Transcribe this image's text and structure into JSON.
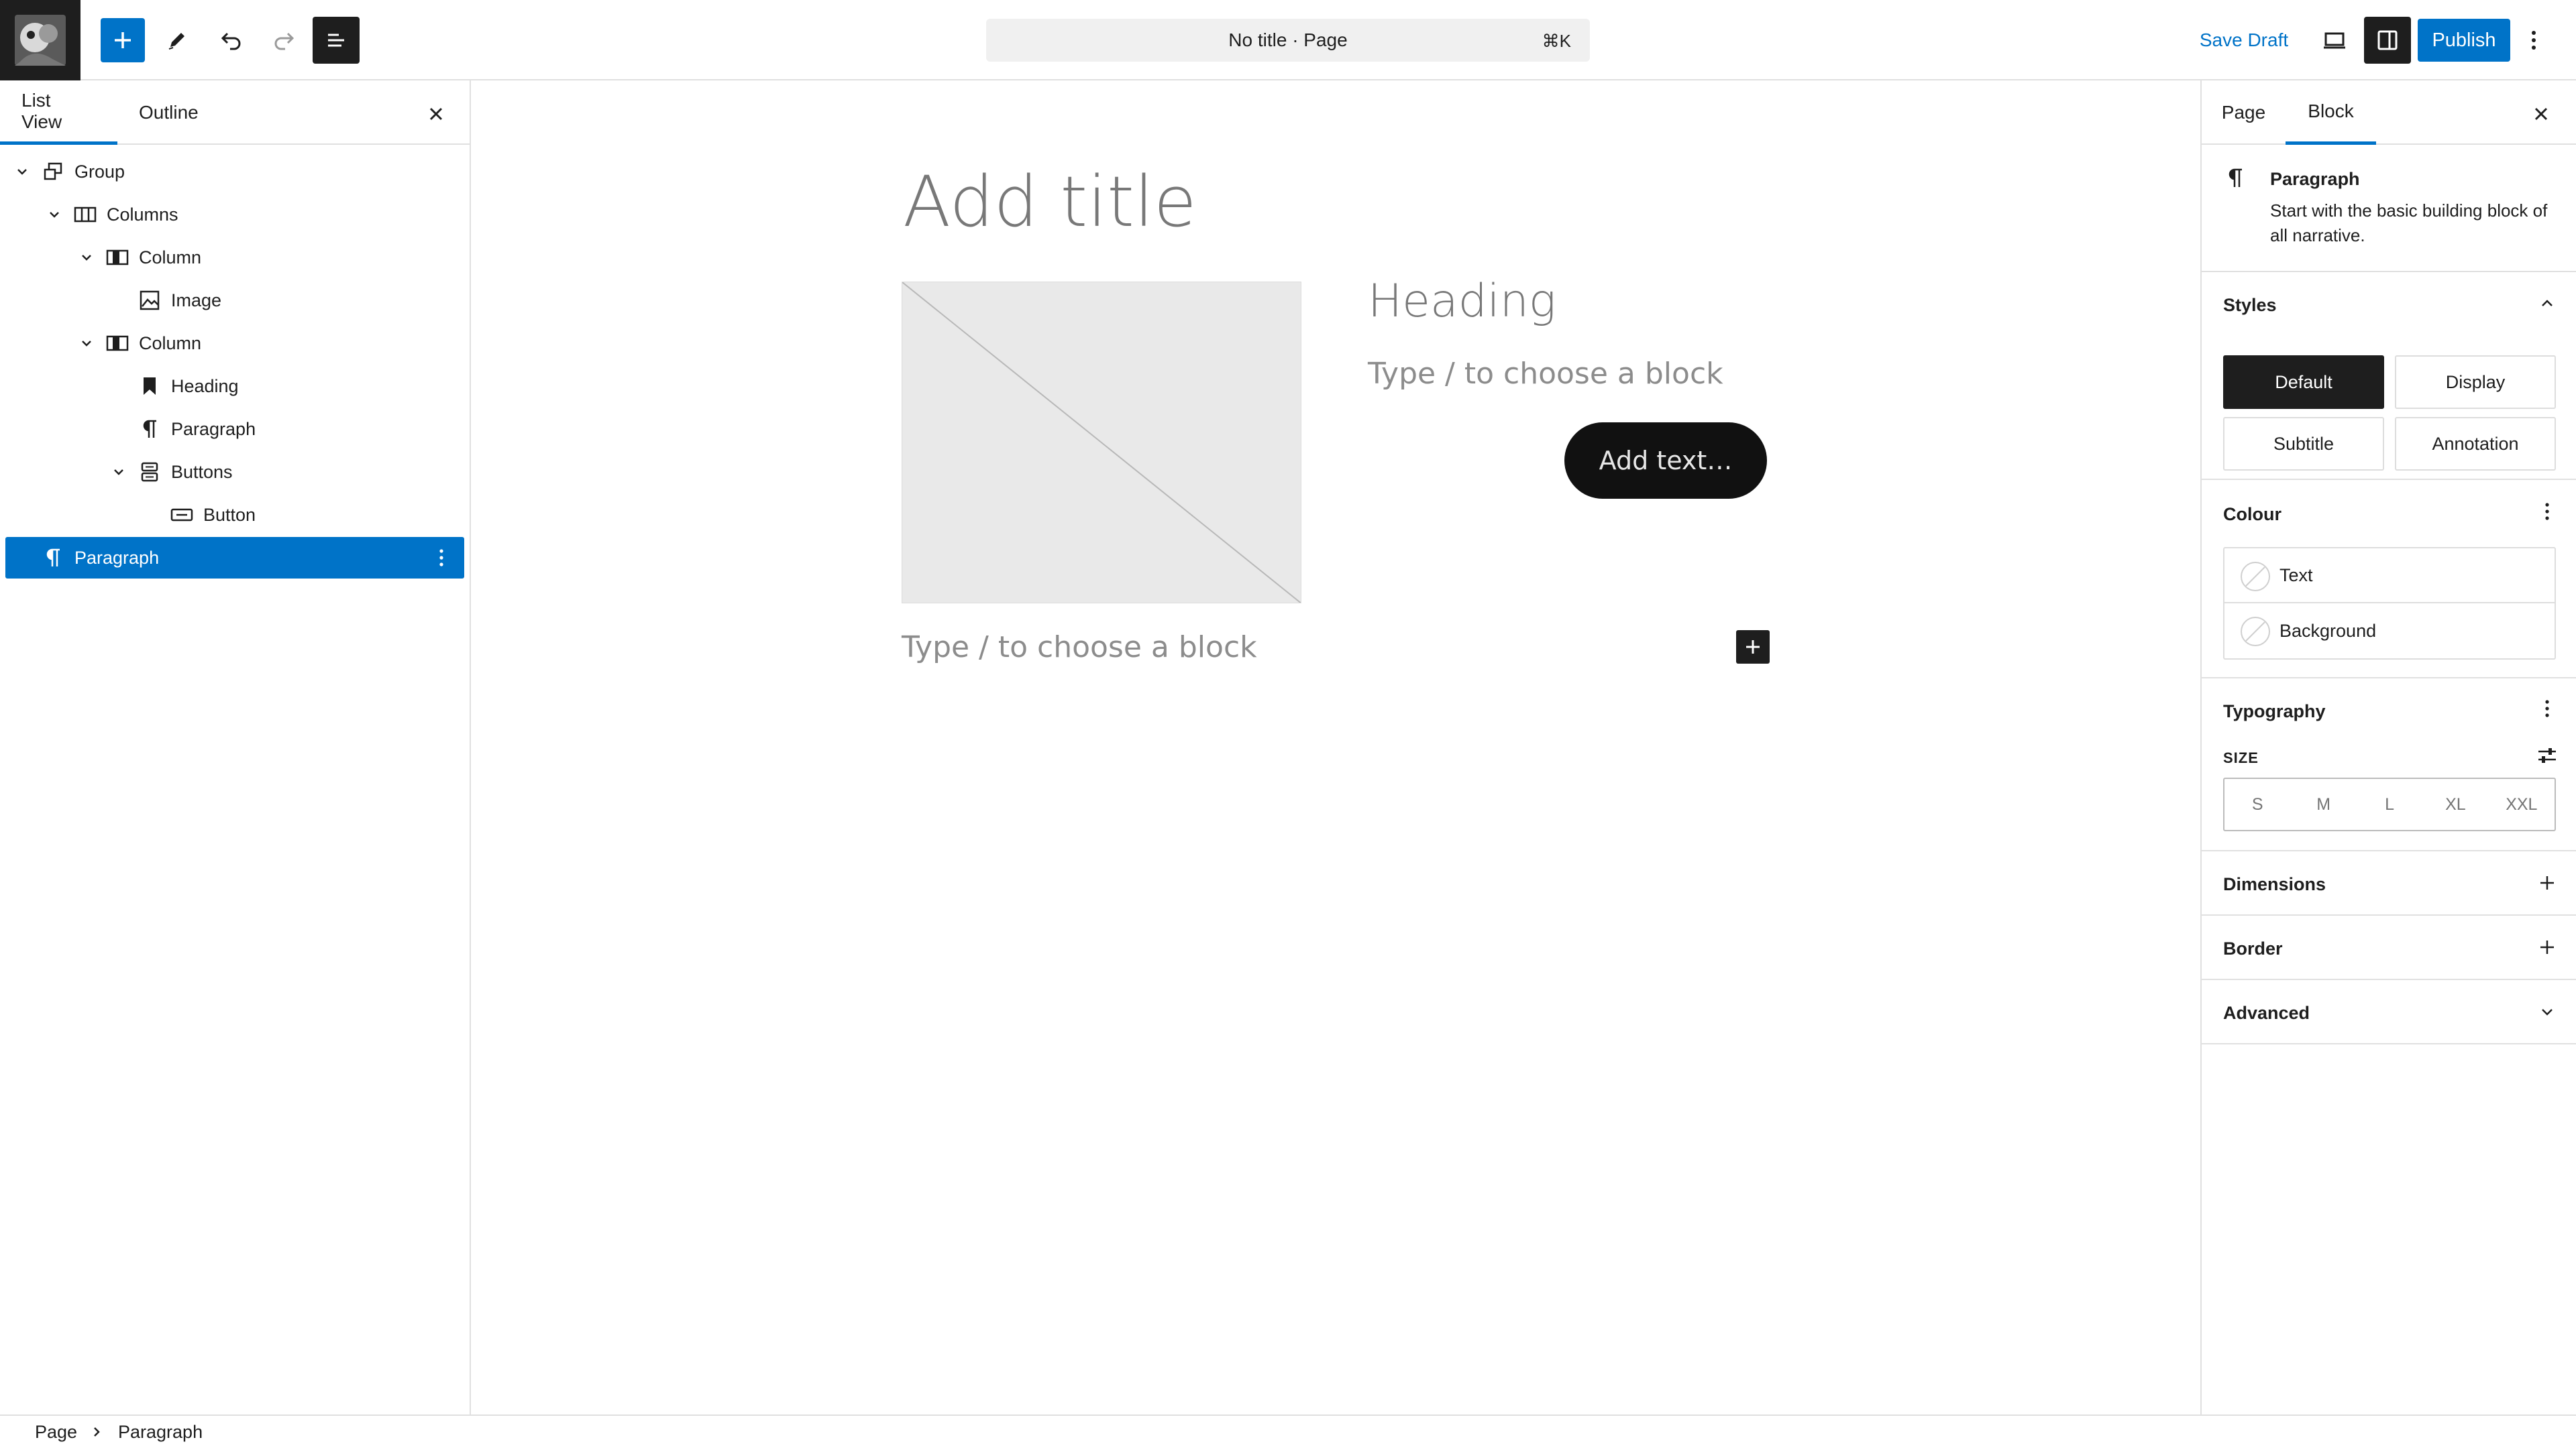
{
  "topbar": {
    "command_title": "No title · Page",
    "command_shortcut": "⌘K",
    "save_draft": "Save Draft",
    "publish": "Publish"
  },
  "left_panel": {
    "tabs": [
      "List View",
      "Outline"
    ],
    "active_tab": "List View",
    "tree": [
      {
        "label": "Group",
        "icon": "group-icon",
        "level": 0,
        "expanded": true
      },
      {
        "label": "Columns",
        "icon": "columns-icon",
        "level": 1,
        "expanded": true
      },
      {
        "label": "Column",
        "icon": "column-icon",
        "level": 2,
        "expanded": true
      },
      {
        "label": "Image",
        "icon": "image-icon",
        "level": 3
      },
      {
        "label": "Column",
        "icon": "column-icon",
        "level": 2,
        "expanded": true
      },
      {
        "label": "Heading",
        "icon": "heading-bookmark-icon",
        "level": 3
      },
      {
        "label": "Paragraph",
        "icon": "pilcrow-icon",
        "level": 3
      },
      {
        "label": "Buttons",
        "icon": "buttons-icon",
        "level": 3,
        "expanded": true
      },
      {
        "label": "Button",
        "icon": "button-icon",
        "level": 4
      },
      {
        "label": "Paragraph",
        "icon": "pilcrow-icon",
        "level": 0,
        "selected": true
      }
    ]
  },
  "canvas": {
    "title_placeholder": "Add title",
    "heading": "Heading",
    "column_paragraph_placeholder": "Type / to choose a block",
    "button_text": "Add text…",
    "paragraph_placeholder": "Type / to choose a block"
  },
  "right_panel": {
    "tabs": [
      "Page",
      "Block"
    ],
    "active_tab": "Block",
    "block_card": {
      "title": "Paragraph",
      "description": "Start with the basic building block of all narrative."
    },
    "styles": {
      "title": "Styles",
      "options": [
        "Default",
        "Display",
        "Subtitle",
        "Annotation"
      ],
      "active": "Default"
    },
    "colour": {
      "title": "Colour",
      "items": [
        "Text",
        "Background"
      ]
    },
    "typography": {
      "title": "Typography",
      "size_label": "SIZE",
      "sizes": [
        "S",
        "M",
        "L",
        "XL",
        "XXL"
      ]
    },
    "dimensions": {
      "title": "Dimensions"
    },
    "border": {
      "title": "Border"
    },
    "advanced": {
      "title": "Advanced"
    }
  },
  "footer": {
    "breadcrumb": [
      "Page",
      "Paragraph"
    ]
  },
  "colors": {
    "accent": "#0073c8",
    "dark": "#1e1e1e"
  }
}
